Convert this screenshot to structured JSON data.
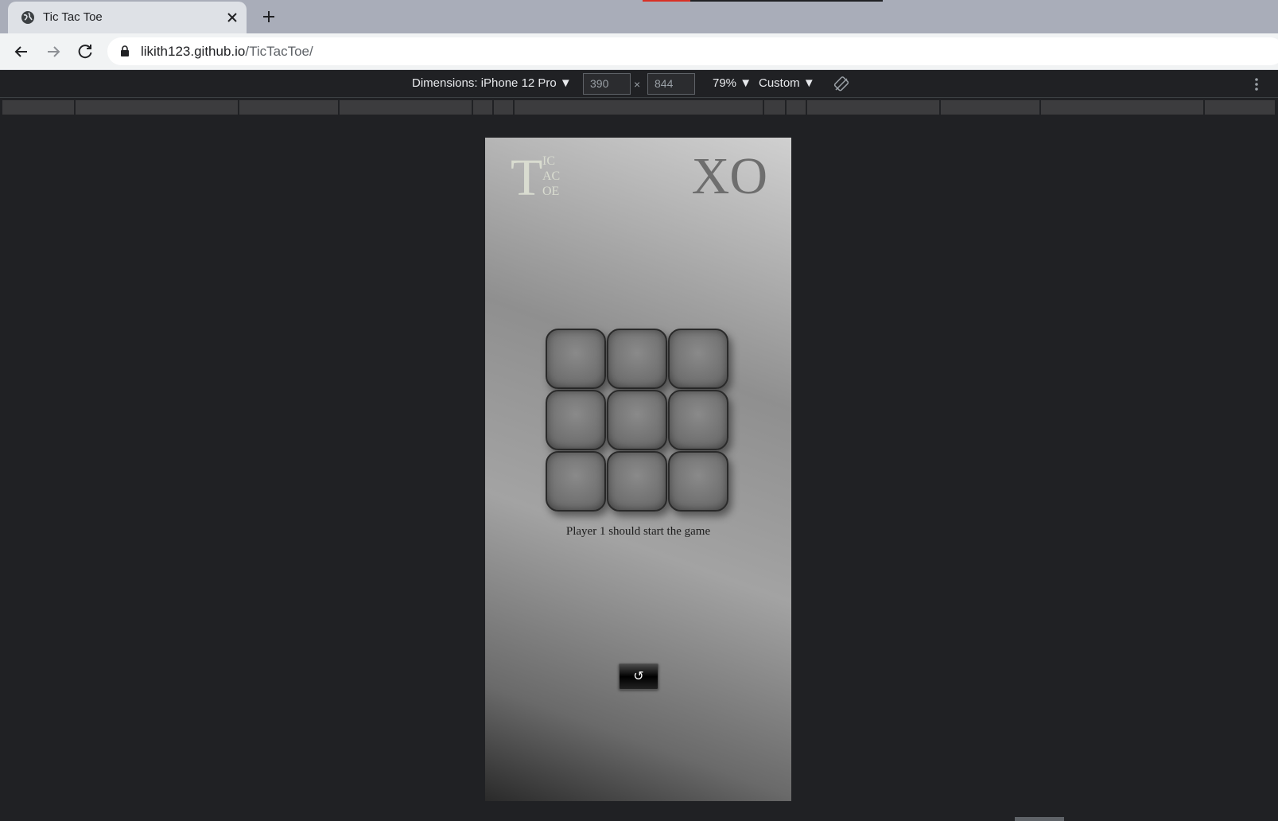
{
  "browser": {
    "tab_title": "Tic Tac Toe",
    "url_host": "likith123.github.io",
    "url_path": "/TicTacToe/"
  },
  "devtools": {
    "dimensions_label": "Dimensions: iPhone 12 Pro ▼",
    "width_value": "390",
    "height_value": "844",
    "times_glyph": "×",
    "zoom_label": "79% ▼",
    "throttle_label": "Custom ▼"
  },
  "page": {
    "logo_big": "T",
    "logo_lines": [
      "IC",
      "AC",
      "OE"
    ],
    "xo_mark": "XO",
    "status_text": "Player 1 should start the game",
    "reset_label": "↺"
  },
  "colors": {
    "page_background": "#202124",
    "cell_border": "#2a2a2a",
    "logo_color": "#d9dcd0"
  },
  "icons": [
    "globe-icon",
    "close-icon",
    "plus-icon",
    "back-arrow-icon",
    "forward-arrow-icon",
    "reload-icon",
    "lock-icon",
    "rotate-icon",
    "more-vert-icon"
  ]
}
